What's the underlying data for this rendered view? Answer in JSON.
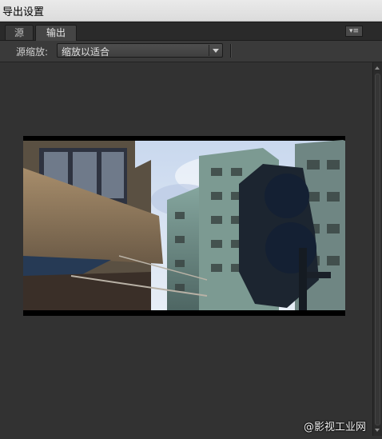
{
  "window": {
    "title": "导出设置"
  },
  "tabs": [
    {
      "label": "源"
    },
    {
      "label": "输出",
      "active": true
    }
  ],
  "toolbar": {
    "source_scale_label": "源缩放:",
    "source_scale_value": "缩放以适合"
  },
  "watermark": "@影视工业网",
  "colors": {
    "panel_bg": "#323232",
    "tab_bar": "#2a2a2a",
    "title_bar": "#e4e4e4"
  },
  "icons": {
    "panel_menu": "panel-menu-icon",
    "dropdown": "chevron-down-icon"
  }
}
